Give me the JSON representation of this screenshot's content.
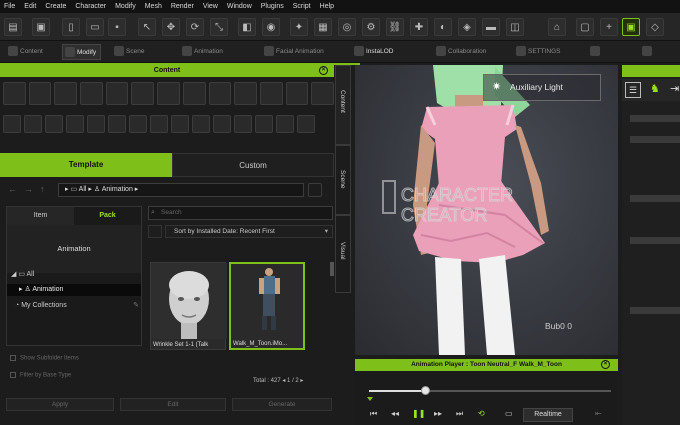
{
  "menu": [
    "File",
    "Edit",
    "Create",
    "Character",
    "Modify",
    "Mesh",
    "Render",
    "View",
    "Window",
    "Plugins",
    "Script",
    "Help"
  ],
  "toolbar2": {
    "tabs": [
      "Content",
      "Modify",
      "Scene",
      "Animation",
      "Facial Animation",
      "InstaLOD",
      "Collaboration",
      "SETTINGS"
    ],
    "active": "Modify"
  },
  "content": {
    "header": "Content",
    "tab_template": "Template",
    "tab_custom": "Custom",
    "breadcrumb": [
      "All",
      "Animation"
    ],
    "left_tabs": [
      "Item",
      "Pack"
    ],
    "selected_pack": "Animation",
    "tree": [
      "All",
      "Animation",
      "My Collections"
    ],
    "search_placeholder": "Search",
    "sort_label": "Sort by Installed Date: Recent First",
    "thumbnails": [
      {
        "caption": "Wrinkle Set 1-1 (Talk"
      },
      {
        "caption": "Walk_M_Toon.iMo..."
      }
    ],
    "total_label": "Total : 427",
    "page_current": "1",
    "page_sep": "/",
    "page_total": "2",
    "checkboxes": [
      "Show Subfolder Items",
      "Filter by Base Type"
    ],
    "bottom_buttons": [
      "Apply",
      "Edit",
      "Generate"
    ]
  },
  "side_tabs": [
    "Content",
    "Scene",
    "Visual"
  ],
  "viewport": {
    "aux_light": "Auxiliary Light",
    "watermark_line1": "CHARACTER",
    "watermark_line2": "CREATOR",
    "bub_label": "Bub0 0"
  },
  "anim_player": {
    "title": "Animation Player : Toon Neutral_F   Walk_M_Toon",
    "realtime_label": "Realtime",
    "progress": 0.23
  },
  "colors": {
    "accent": "#7fbf1a",
    "pink_dress": "#e9a0b8",
    "hair": "#9fe0a8"
  }
}
